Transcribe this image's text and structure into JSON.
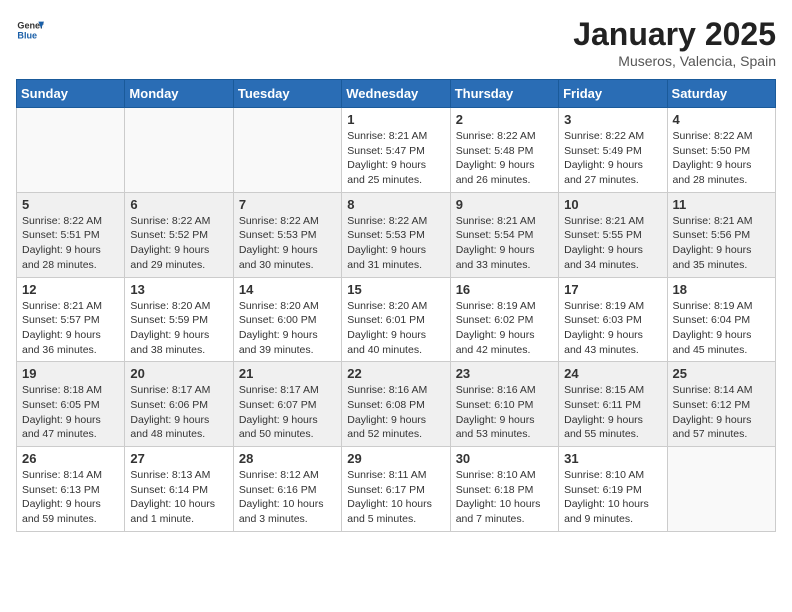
{
  "header": {
    "logo_general": "General",
    "logo_blue": "Blue",
    "month": "January 2025",
    "location": "Museros, Valencia, Spain"
  },
  "weekdays": [
    "Sunday",
    "Monday",
    "Tuesday",
    "Wednesday",
    "Thursday",
    "Friday",
    "Saturday"
  ],
  "weeks": [
    [
      {
        "day": "",
        "info": ""
      },
      {
        "day": "",
        "info": ""
      },
      {
        "day": "",
        "info": ""
      },
      {
        "day": "1",
        "info": "Sunrise: 8:21 AM\nSunset: 5:47 PM\nDaylight: 9 hours\nand 25 minutes."
      },
      {
        "day": "2",
        "info": "Sunrise: 8:22 AM\nSunset: 5:48 PM\nDaylight: 9 hours\nand 26 minutes."
      },
      {
        "day": "3",
        "info": "Sunrise: 8:22 AM\nSunset: 5:49 PM\nDaylight: 9 hours\nand 27 minutes."
      },
      {
        "day": "4",
        "info": "Sunrise: 8:22 AM\nSunset: 5:50 PM\nDaylight: 9 hours\nand 28 minutes."
      }
    ],
    [
      {
        "day": "5",
        "info": "Sunrise: 8:22 AM\nSunset: 5:51 PM\nDaylight: 9 hours\nand 28 minutes."
      },
      {
        "day": "6",
        "info": "Sunrise: 8:22 AM\nSunset: 5:52 PM\nDaylight: 9 hours\nand 29 minutes."
      },
      {
        "day": "7",
        "info": "Sunrise: 8:22 AM\nSunset: 5:53 PM\nDaylight: 9 hours\nand 30 minutes."
      },
      {
        "day": "8",
        "info": "Sunrise: 8:22 AM\nSunset: 5:53 PM\nDaylight: 9 hours\nand 31 minutes."
      },
      {
        "day": "9",
        "info": "Sunrise: 8:21 AM\nSunset: 5:54 PM\nDaylight: 9 hours\nand 33 minutes."
      },
      {
        "day": "10",
        "info": "Sunrise: 8:21 AM\nSunset: 5:55 PM\nDaylight: 9 hours\nand 34 minutes."
      },
      {
        "day": "11",
        "info": "Sunrise: 8:21 AM\nSunset: 5:56 PM\nDaylight: 9 hours\nand 35 minutes."
      }
    ],
    [
      {
        "day": "12",
        "info": "Sunrise: 8:21 AM\nSunset: 5:57 PM\nDaylight: 9 hours\nand 36 minutes."
      },
      {
        "day": "13",
        "info": "Sunrise: 8:20 AM\nSunset: 5:59 PM\nDaylight: 9 hours\nand 38 minutes."
      },
      {
        "day": "14",
        "info": "Sunrise: 8:20 AM\nSunset: 6:00 PM\nDaylight: 9 hours\nand 39 minutes."
      },
      {
        "day": "15",
        "info": "Sunrise: 8:20 AM\nSunset: 6:01 PM\nDaylight: 9 hours\nand 40 minutes."
      },
      {
        "day": "16",
        "info": "Sunrise: 8:19 AM\nSunset: 6:02 PM\nDaylight: 9 hours\nand 42 minutes."
      },
      {
        "day": "17",
        "info": "Sunrise: 8:19 AM\nSunset: 6:03 PM\nDaylight: 9 hours\nand 43 minutes."
      },
      {
        "day": "18",
        "info": "Sunrise: 8:19 AM\nSunset: 6:04 PM\nDaylight: 9 hours\nand 45 minutes."
      }
    ],
    [
      {
        "day": "19",
        "info": "Sunrise: 8:18 AM\nSunset: 6:05 PM\nDaylight: 9 hours\nand 47 minutes."
      },
      {
        "day": "20",
        "info": "Sunrise: 8:17 AM\nSunset: 6:06 PM\nDaylight: 9 hours\nand 48 minutes."
      },
      {
        "day": "21",
        "info": "Sunrise: 8:17 AM\nSunset: 6:07 PM\nDaylight: 9 hours\nand 50 minutes."
      },
      {
        "day": "22",
        "info": "Sunrise: 8:16 AM\nSunset: 6:08 PM\nDaylight: 9 hours\nand 52 minutes."
      },
      {
        "day": "23",
        "info": "Sunrise: 8:16 AM\nSunset: 6:10 PM\nDaylight: 9 hours\nand 53 minutes."
      },
      {
        "day": "24",
        "info": "Sunrise: 8:15 AM\nSunset: 6:11 PM\nDaylight: 9 hours\nand 55 minutes."
      },
      {
        "day": "25",
        "info": "Sunrise: 8:14 AM\nSunset: 6:12 PM\nDaylight: 9 hours\nand 57 minutes."
      }
    ],
    [
      {
        "day": "26",
        "info": "Sunrise: 8:14 AM\nSunset: 6:13 PM\nDaylight: 9 hours\nand 59 minutes."
      },
      {
        "day": "27",
        "info": "Sunrise: 8:13 AM\nSunset: 6:14 PM\nDaylight: 10 hours\nand 1 minute."
      },
      {
        "day": "28",
        "info": "Sunrise: 8:12 AM\nSunset: 6:16 PM\nDaylight: 10 hours\nand 3 minutes."
      },
      {
        "day": "29",
        "info": "Sunrise: 8:11 AM\nSunset: 6:17 PM\nDaylight: 10 hours\nand 5 minutes."
      },
      {
        "day": "30",
        "info": "Sunrise: 8:10 AM\nSunset: 6:18 PM\nDaylight: 10 hours\nand 7 minutes."
      },
      {
        "day": "31",
        "info": "Sunrise: 8:10 AM\nSunset: 6:19 PM\nDaylight: 10 hours\nand 9 minutes."
      },
      {
        "day": "",
        "info": ""
      }
    ]
  ]
}
